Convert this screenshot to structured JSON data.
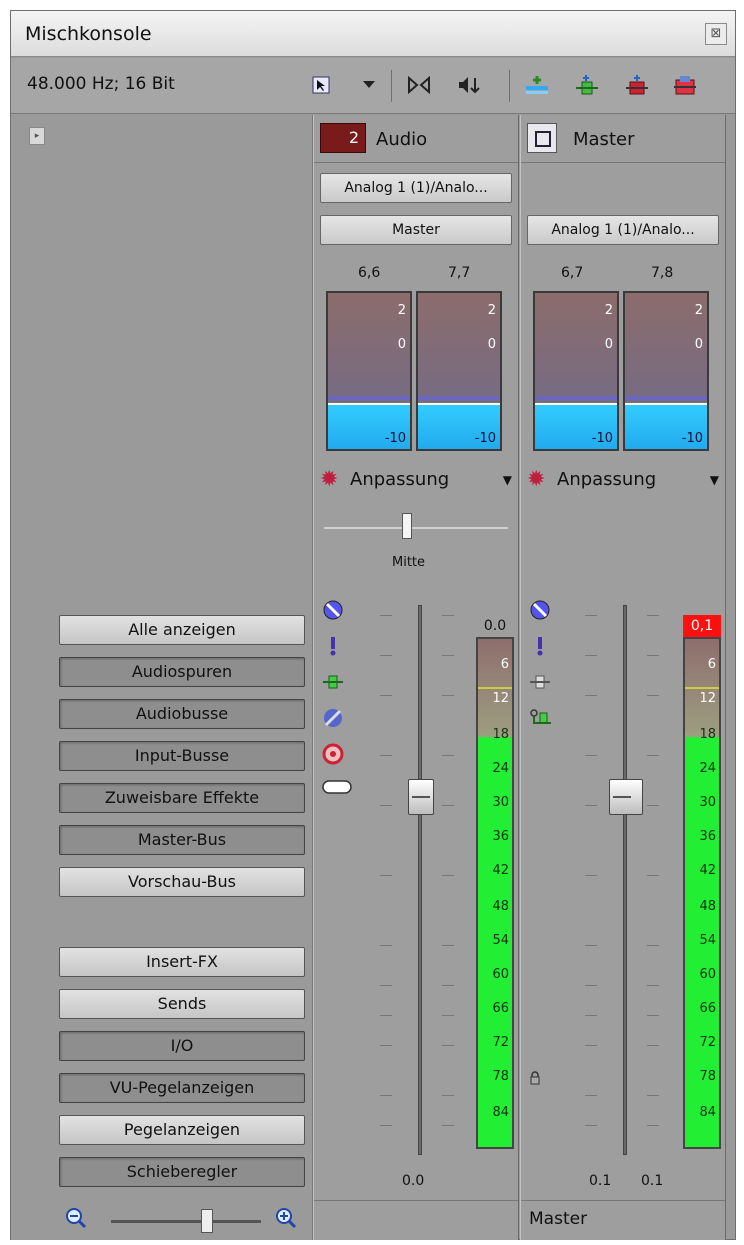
{
  "window": {
    "title": "Mischkonsole",
    "close_glyph": "⊠"
  },
  "toolbar": {
    "format": "48.000 Hz; 16 Bit",
    "icons": [
      "select-icon",
      "dropdown-icon",
      "downmix-icon",
      "dim-icon",
      "insert-bus-icon",
      "insert-fx-icon",
      "insert-assignable-icon",
      "insert-input-bus-icon"
    ]
  },
  "view_buttons": {
    "group1": [
      {
        "label": "Alle anzeigen",
        "active": true
      },
      {
        "label": "Audiospuren",
        "active": false
      },
      {
        "label": "Audiobusse",
        "active": false
      },
      {
        "label": "Input-Busse",
        "active": false
      },
      {
        "label": "Zuweisbare Effekte",
        "active": false
      },
      {
        "label": "Master-Bus",
        "active": false
      },
      {
        "label": "Vorschau-Bus",
        "active": true
      }
    ],
    "group2": [
      {
        "label": "Insert-FX",
        "active": true
      },
      {
        "label": "Sends",
        "active": true
      },
      {
        "label": "I/O",
        "active": false
      },
      {
        "label": "VU-Pegelanzeigen",
        "active": false
      },
      {
        "label": "Pegelanzeigen",
        "active": true
      },
      {
        "label": "Schieberegler",
        "active": false
      }
    ]
  },
  "channels": [
    {
      "number": "2",
      "name": "Audio",
      "input": "Analog 1 (1)/Analo...",
      "output": "Master",
      "vu_peaks": [
        "6,6",
        "7,7"
      ],
      "fx": "Anpassung",
      "pan_label": "Mitte",
      "peak": "0.0",
      "fader_value": "0.0",
      "footer": ""
    },
    {
      "number": "",
      "name": "Master",
      "input": "",
      "output": "Analog 1 (1)/Analo...",
      "vu_peaks": [
        "6,7",
        "7,8"
      ],
      "fx": "Anpassung",
      "pan_label": "",
      "peak": "0,1",
      "fader_values": [
        "0.1",
        "0.1"
      ],
      "footer": "Master"
    }
  ],
  "vu_ticks": [
    "2",
    "0",
    "-10"
  ],
  "meter_ticks": [
    "6",
    "12",
    "18",
    "24",
    "30",
    "36",
    "42",
    "48",
    "54",
    "60",
    "66",
    "72",
    "78",
    "84"
  ],
  "colors": {
    "record": "#7a1b1b",
    "meter_green": "#22ee33",
    "vu_cyan": "#33ccff",
    "peak_red": "#ff1010"
  }
}
